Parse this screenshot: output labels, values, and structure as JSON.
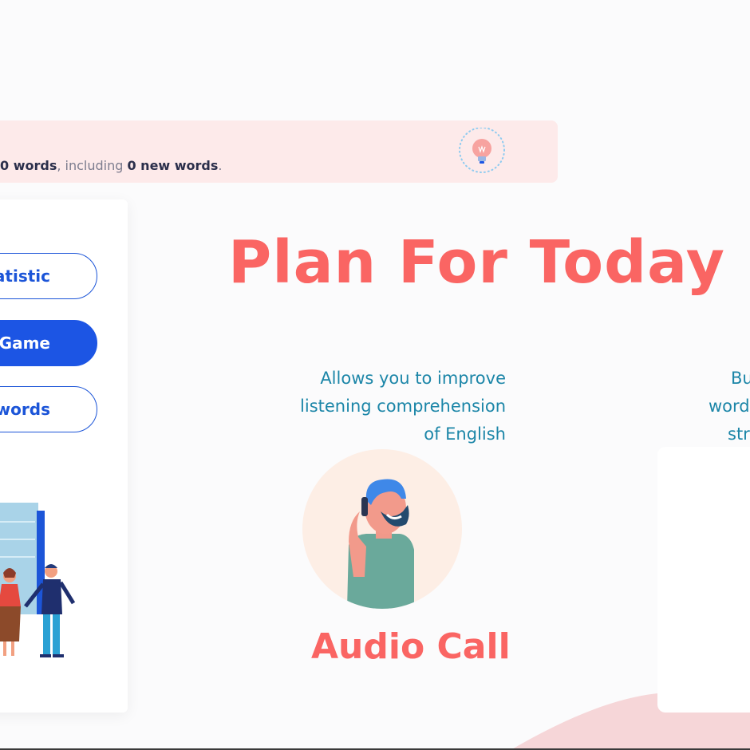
{
  "banner": {
    "count_words": "0 words",
    "including": ", including ",
    "count_new": "0 new words",
    "period": ".",
    "icon": "lightbulb-icon"
  },
  "sidebar": {
    "buttons": [
      {
        "label": "Statistic"
      },
      {
        "label": "Main Game"
      },
      {
        "label": "Learning words"
      }
    ]
  },
  "main": {
    "title": "Plan For Today",
    "cards": [
      {
        "description": [
          "Allows you to improve",
          "listening comprehension",
          "of English"
        ],
        "title": "Audio Call",
        "icon": "man-on-phone-icon"
      },
      {
        "description": [
          "Bu",
          "word",
          "",
          "str"
        ]
      }
    ]
  },
  "colors": {
    "accent": "#fa6563",
    "primary": "#1c55e4",
    "teal": "#1c86a8",
    "banner_bg": "#fdeaea"
  }
}
